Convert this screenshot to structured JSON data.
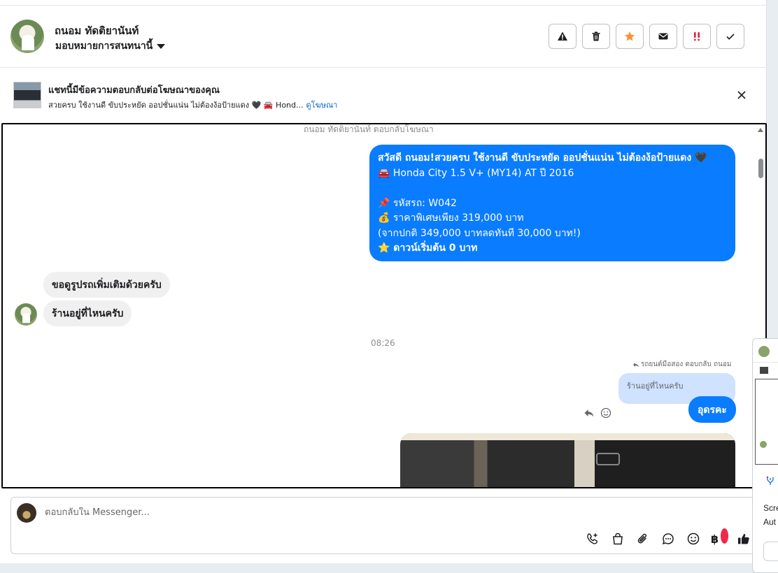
{
  "header": {
    "name": "ถนอม ทัดติยานันท์",
    "assign_label": "มอบหมายการสนทนานี้"
  },
  "banner": {
    "title": "แชทนี้มีข้อความตอบกลับต่อโฆษณาของคุณ",
    "subtitle": "สวยครบ ใช้งานดี ขับประหยัด ออปชั่นแน่น ไม่ต้องง้อป้ายแดง 🖤 🚘 Hond...",
    "link": "ดูโฆษณา"
  },
  "chat": {
    "system_top": "ถนอม ทัดติยานันท์ ตอบกลับโฆษณา",
    "outgoing_1": {
      "line1": "สวัสดี ถนอม!สวยครบ ใช้งานดี ขับประหยัด ออปชั่นแน่น ไม่ต้องง้อป้ายแดง 🖤",
      "line2": "🚘 Honda City 1.5 V+ (MY14) AT ปี 2016",
      "line3": "📌 รหัสรถ: W042",
      "line4": "💰 ราคาพิเศษเพียง 319,000 บาท",
      "line5": "(จากปกติ 349,000 บาทลดทันที 30,000 บาท!)",
      "line6": "⭐ ดาวน์เริ่มต้น 0 บาท"
    },
    "incoming_1": "ขอดูรูปรถเพิ่มเติมด้วยครับ",
    "incoming_2": "ร้านอยู่ที่ไหนครับ",
    "time": "08:26",
    "reply_meta": "รถยนต์มือสอง ตอบกลับ ถนอม",
    "quoted": "ร้านอยู่ที่ไหนครับ",
    "outgoing_2": "อุดรคะ"
  },
  "composer": {
    "placeholder": "ตอบกลับใน Messenger..."
  },
  "side_panel": {
    "text1": "Scre",
    "text2": "Aut"
  }
}
